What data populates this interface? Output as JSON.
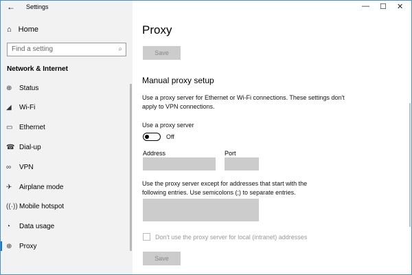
{
  "window": {
    "title": "Settings",
    "minimize": "—",
    "maximize": "☐",
    "close": "✕",
    "back": "←"
  },
  "sidebar": {
    "home": "Home",
    "search_placeholder": "Find a setting",
    "section": "Network & Internet",
    "items": [
      {
        "label": "Status",
        "icon": "⊕"
      },
      {
        "label": "Wi-Fi",
        "icon": "◢"
      },
      {
        "label": "Ethernet",
        "icon": "▭"
      },
      {
        "label": "Dial-up",
        "icon": "☎"
      },
      {
        "label": "VPN",
        "icon": "∞"
      },
      {
        "label": "Airplane mode",
        "icon": "✈"
      },
      {
        "label": "Mobile hotspot",
        "icon": "((·))"
      },
      {
        "label": "Data usage",
        "icon": "◔"
      },
      {
        "label": "Proxy",
        "icon": "⊕"
      }
    ]
  },
  "main": {
    "title": "Proxy",
    "save_top": "Save",
    "heading": "Manual proxy setup",
    "desc": "Use a proxy server for Ethernet or Wi-Fi connections. These settings don't apply to VPN connections.",
    "use_proxy_label": "Use a proxy server",
    "toggle_state": "Off",
    "address_label": "Address",
    "address_value": "",
    "port_label": "Port",
    "port_value": "",
    "exceptions_desc": "Use the proxy server except for addresses that start with the following entries. Use semicolons (;) to separate entries.",
    "exceptions_value": "",
    "local_checkbox": "Don't use the proxy server for local (intranet) addresses",
    "save_bottom": "Save"
  }
}
